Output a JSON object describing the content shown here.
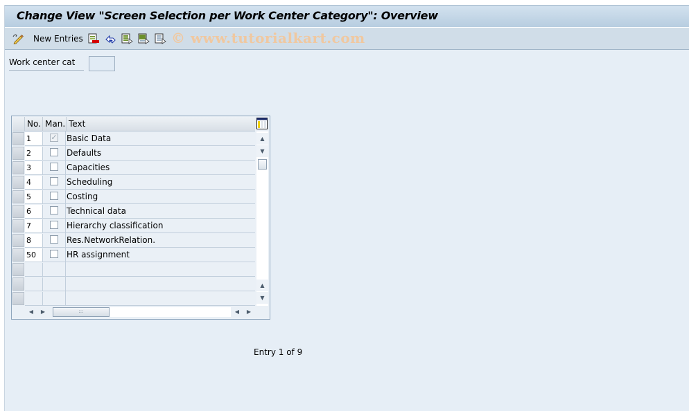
{
  "window": {
    "title": "Change View \"Screen Selection per Work Center Category\": Overview"
  },
  "toolbar": {
    "items": [
      {
        "icon": "change-display-icon",
        "label": ""
      },
      {
        "icon": "",
        "label": "New Entries"
      },
      {
        "icon": "delete-icon",
        "label": ""
      },
      {
        "icon": "undo-change-icon",
        "label": ""
      },
      {
        "icon": "select-all-icon",
        "label": ""
      },
      {
        "icon": "select-block-icon",
        "label": ""
      },
      {
        "icon": "deselect-all-icon",
        "label": ""
      }
    ],
    "watermark": "© www.tutorialkart.com"
  },
  "filter": {
    "label": "Work center cat",
    "value": ""
  },
  "table": {
    "columns": [
      "No.",
      "Man.",
      "Text"
    ],
    "rows": [
      {
        "no": "1",
        "man": true,
        "man_disabled": true,
        "text": "Basic Data"
      },
      {
        "no": "2",
        "man": false,
        "man_disabled": false,
        "text": "Defaults"
      },
      {
        "no": "3",
        "man": false,
        "man_disabled": false,
        "text": "Capacities"
      },
      {
        "no": "4",
        "man": false,
        "man_disabled": false,
        "text": "Scheduling"
      },
      {
        "no": "5",
        "man": false,
        "man_disabled": false,
        "text": "Costing"
      },
      {
        "no": "6",
        "man": false,
        "man_disabled": false,
        "text": "Technical data"
      },
      {
        "no": "7",
        "man": false,
        "man_disabled": false,
        "text": "Hierarchy classification"
      },
      {
        "no": "8",
        "man": false,
        "man_disabled": false,
        "text": "Res.NetworkRelation."
      },
      {
        "no": "50",
        "man": false,
        "man_disabled": false,
        "text": "HR assignment"
      }
    ],
    "empty_rows": 3,
    "config_icon": "table-settings-icon"
  },
  "status": {
    "entry_text": "Entry 1 of 9"
  },
  "colors": {
    "background": "#e6eef6",
    "title_bar": "#b7cde0",
    "toolbar": "#d0dde8",
    "watermark": "#f0c8a0"
  }
}
